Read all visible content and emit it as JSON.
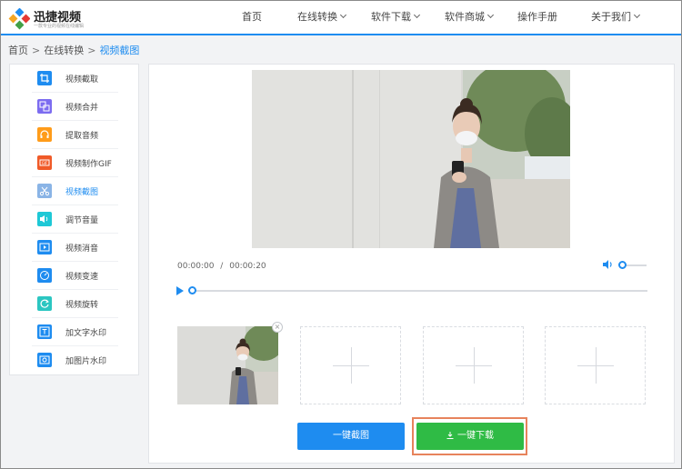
{
  "brand": {
    "name": "迅捷视频",
    "tagline": "一款专业的视频在线编辑"
  },
  "nav": {
    "items": [
      {
        "label": "首页",
        "dropdown": false
      },
      {
        "label": "在线转换",
        "dropdown": true
      },
      {
        "label": "软件下载",
        "dropdown": true
      },
      {
        "label": "软件商城",
        "dropdown": true
      },
      {
        "label": "操作手册",
        "dropdown": false
      },
      {
        "label": "关于我们",
        "dropdown": true
      }
    ]
  },
  "breadcrumb": {
    "home": "首页",
    "separator": ">",
    "section": "在线转换",
    "current": "视频截图"
  },
  "sidebar": {
    "active_index": 4,
    "items": [
      {
        "label": "视频截取",
        "icon": "crop-icon"
      },
      {
        "label": "视频合并",
        "icon": "merge-icon"
      },
      {
        "label": "提取音频",
        "icon": "headphones-icon"
      },
      {
        "label": "视频制作GIF",
        "icon": "gif-icon"
      },
      {
        "label": "视频截图",
        "icon": "scissors-icon"
      },
      {
        "label": "调节音量",
        "icon": "volume-icon"
      },
      {
        "label": "视频消音",
        "icon": "mute-video-icon"
      },
      {
        "label": "视频变速",
        "icon": "speed-gauge-icon"
      },
      {
        "label": "视频旋转",
        "icon": "rotate-icon"
      },
      {
        "label": "加文字水印",
        "icon": "text-watermark-icon"
      },
      {
        "label": "加图片水印",
        "icon": "image-watermark-icon"
      }
    ]
  },
  "player": {
    "current_time": "00:00:00",
    "time_separator": "/",
    "duration": "00:00:20",
    "progress": 0,
    "volume_level": 0
  },
  "screenshots": {
    "slots": [
      {
        "filled": true
      },
      {
        "filled": false
      },
      {
        "filled": false
      },
      {
        "filled": false
      }
    ]
  },
  "actions": {
    "capture_label": "一键截图",
    "download_label": "一键下载"
  },
  "colors": {
    "accent": "#1e8cf0",
    "download": "#2fbb45",
    "highlight_outline": "#e7835c"
  }
}
